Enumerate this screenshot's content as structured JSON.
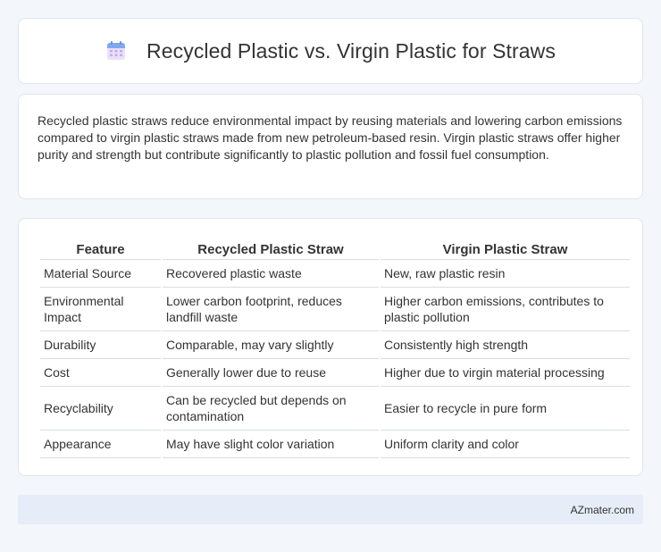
{
  "header": {
    "icon": "calendar-icon",
    "title": "Recycled Plastic vs. Virgin Plastic for Straws"
  },
  "summary": {
    "text": "Recycled plastic straws reduce environmental impact by reusing materials and lowering carbon emissions compared to virgin plastic straws made from new petroleum-based resin. Virgin plastic straws offer higher purity and strength but contribute significantly to plastic pollution and fossil fuel consumption."
  },
  "table": {
    "headers": [
      "Feature",
      "Recycled Plastic Straw",
      "Virgin Plastic Straw"
    ],
    "rows": [
      [
        "Material Source",
        "Recovered plastic waste",
        "New, raw plastic resin"
      ],
      [
        "Environmental Impact",
        "Lower carbon footprint, reduces landfill waste",
        "Higher carbon emissions, contributes to plastic pollution"
      ],
      [
        "Durability",
        "Comparable, may vary slightly",
        "Consistently high strength"
      ],
      [
        "Cost",
        "Generally lower due to reuse",
        "Higher due to virgin material processing"
      ],
      [
        "Recyclability",
        "Can be recycled but depends on contamination",
        "Easier to recycle in pure form"
      ],
      [
        "Appearance",
        "May have slight color variation",
        "Uniform clarity and color"
      ]
    ]
  },
  "footer": {
    "text": "AZmater.com"
  },
  "colors": {
    "background": "#f3f6fb",
    "card": "#ffffff",
    "footer": "#e6edf8",
    "icon_top": "#7aa9f0",
    "icon_body": "#e7dcf7"
  }
}
